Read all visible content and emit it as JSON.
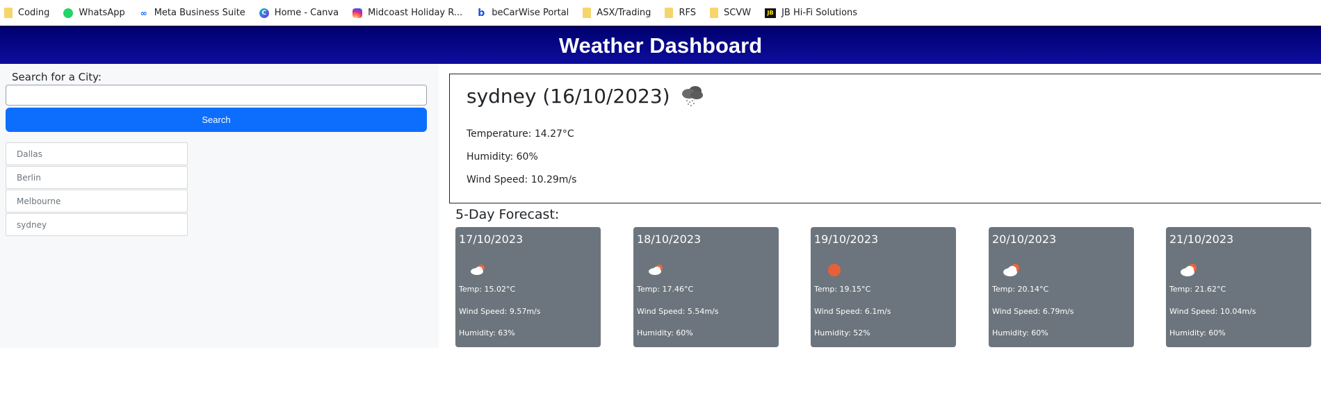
{
  "bookmarks": [
    {
      "label": "Coding",
      "icon": "folder-icon"
    },
    {
      "label": "WhatsApp",
      "icon": "whatsapp-icon"
    },
    {
      "label": "Meta Business Suite",
      "icon": "meta-icon"
    },
    {
      "label": "Home - Canva",
      "icon": "canva-icon"
    },
    {
      "label": "Midcoast Holiday R...",
      "icon": "instagram-icon"
    },
    {
      "label": "beCarWise Portal",
      "icon": "becarwise-icon"
    },
    {
      "label": "ASX/Trading",
      "icon": "folder-icon"
    },
    {
      "label": "RFS",
      "icon": "folder-icon"
    },
    {
      "label": "SCVW",
      "icon": "folder-icon"
    },
    {
      "label": "JB Hi-Fi Solutions",
      "icon": "jbhifi-icon"
    }
  ],
  "header": {
    "title": "Weather Dashboard",
    "background": "#000080"
  },
  "search": {
    "label": "Search for a City:",
    "value": "",
    "placeholder": "",
    "button_label": "Search",
    "button_color": "#0d6efd"
  },
  "history": [
    "Dallas",
    "Berlin",
    "Melbourne",
    "sydney"
  ],
  "current": {
    "title": "sydney (16/10/2023)",
    "icon": "rain-cloud-icon",
    "temperature": "Temperature: 14.27°C",
    "humidity": "Humidity: 60%",
    "wind": "Wind Speed: 10.29m/s"
  },
  "forecast": {
    "title": "5-Day Forecast:",
    "card_color": "#6c757d",
    "days": [
      {
        "date": "17/10/2023",
        "icon": "partly-cloudy-icon",
        "temp": "Temp: 15.02°C",
        "wind": "Wind Speed: 9.57m/s",
        "humidity": "Humidity: 63%"
      },
      {
        "date": "18/10/2023",
        "icon": "partly-cloudy-icon",
        "temp": "Temp: 17.46°C",
        "wind": "Wind Speed: 5.54m/s",
        "humidity": "Humidity: 60%"
      },
      {
        "date": "19/10/2023",
        "icon": "sun-icon",
        "temp": "Temp: 19.15°C",
        "wind": "Wind Speed: 6.1m/s",
        "humidity": "Humidity: 52%"
      },
      {
        "date": "20/10/2023",
        "icon": "partly-cloudy-icon",
        "temp": "Temp: 20.14°C",
        "wind": "Wind Speed: 6.79m/s",
        "humidity": "Humidity: 60%"
      },
      {
        "date": "21/10/2023",
        "icon": "partly-cloudy-icon",
        "temp": "Temp: 21.62°C",
        "wind": "Wind Speed: 10.04m/s",
        "humidity": "Humidity: 60%"
      }
    ]
  }
}
